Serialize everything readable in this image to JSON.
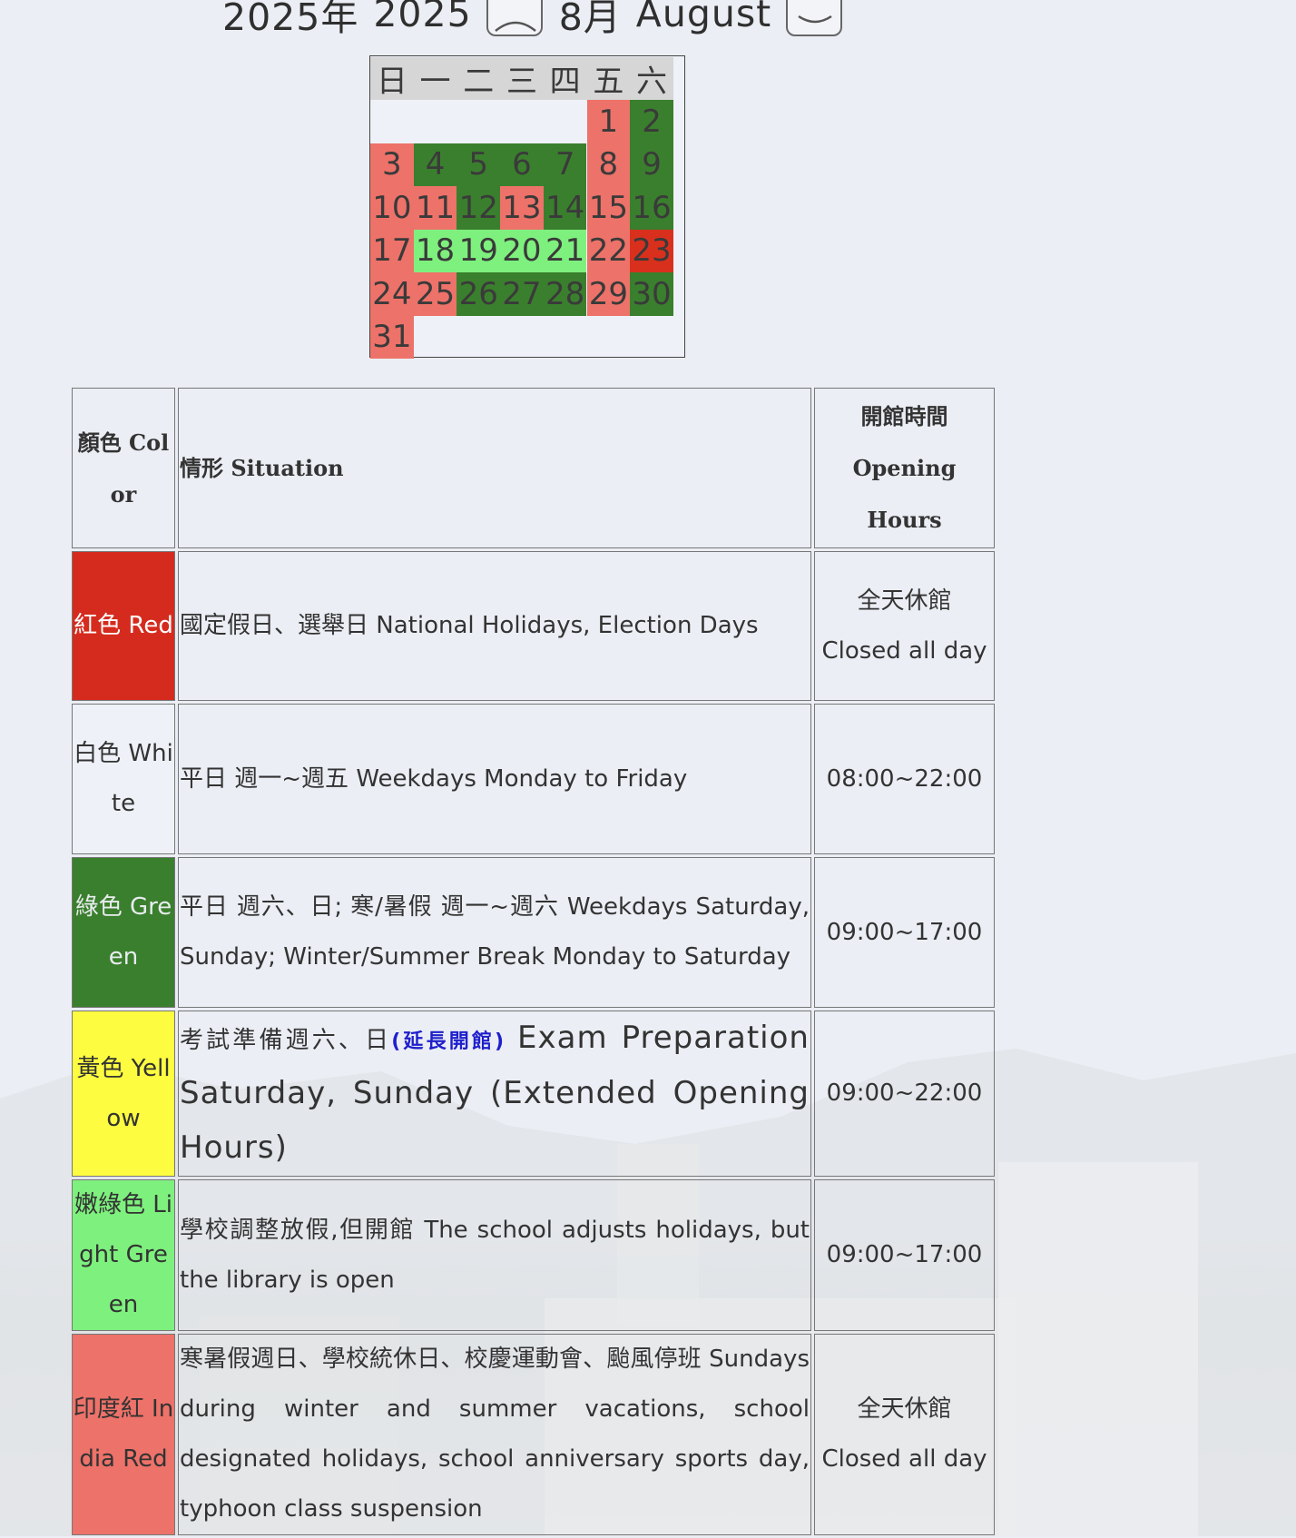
{
  "header": {
    "year_label": "2025年",
    "year_value": "2025",
    "month_label": "8月",
    "month_value": "August"
  },
  "calendar": {
    "weekdays": [
      "日",
      "一",
      "二",
      "三",
      "四",
      "五",
      "六"
    ],
    "days": [
      {
        "day": "1",
        "col": 5,
        "row": 0,
        "color": "#ed7269"
      },
      {
        "day": "2",
        "col": 6,
        "row": 0,
        "color": "#3a7f2d"
      },
      {
        "day": "3",
        "col": 0,
        "row": 1,
        "color": "#ed7269"
      },
      {
        "day": "4",
        "col": 1,
        "row": 1,
        "color": "#3a7f2d"
      },
      {
        "day": "5",
        "col": 2,
        "row": 1,
        "color": "#3a7f2d"
      },
      {
        "day": "6",
        "col": 3,
        "row": 1,
        "color": "#3a7f2d"
      },
      {
        "day": "7",
        "col": 4,
        "row": 1,
        "color": "#3a7f2d"
      },
      {
        "day": "8",
        "col": 5,
        "row": 1,
        "color": "#ed7269"
      },
      {
        "day": "9",
        "col": 6,
        "row": 1,
        "color": "#3a7f2d"
      },
      {
        "day": "10",
        "col": 0,
        "row": 2,
        "color": "#ed7269"
      },
      {
        "day": "11",
        "col": 1,
        "row": 2,
        "color": "#ed7269"
      },
      {
        "day": "12",
        "col": 2,
        "row": 2,
        "color": "#3a7f2d"
      },
      {
        "day": "13",
        "col": 3,
        "row": 2,
        "color": "#ed7269"
      },
      {
        "day": "14",
        "col": 4,
        "row": 2,
        "color": "#3a7f2d"
      },
      {
        "day": "15",
        "col": 5,
        "row": 2,
        "color": "#ed7269"
      },
      {
        "day": "16",
        "col": 6,
        "row": 2,
        "color": "#3a7f2d"
      },
      {
        "day": "17",
        "col": 0,
        "row": 3,
        "color": "#ed7269"
      },
      {
        "day": "18",
        "col": 1,
        "row": 3,
        "color": "#7ef07e"
      },
      {
        "day": "19",
        "col": 2,
        "row": 3,
        "color": "#7ef07e"
      },
      {
        "day": "20",
        "col": 3,
        "row": 3,
        "color": "#7ef07e"
      },
      {
        "day": "21",
        "col": 4,
        "row": 3,
        "color": "#7ef07e"
      },
      {
        "day": "22",
        "col": 5,
        "row": 3,
        "color": "#ed7269"
      },
      {
        "day": "23",
        "col": 6,
        "row": 3,
        "color": "#d9301e"
      },
      {
        "day": "24",
        "col": 0,
        "row": 4,
        "color": "#ed7269"
      },
      {
        "day": "25",
        "col": 1,
        "row": 4,
        "color": "#ed7269"
      },
      {
        "day": "26",
        "col": 2,
        "row": 4,
        "color": "#3a7f2d"
      },
      {
        "day": "27",
        "col": 3,
        "row": 4,
        "color": "#3a7f2d"
      },
      {
        "day": "28",
        "col": 4,
        "row": 4,
        "color": "#3a7f2d"
      },
      {
        "day": "29",
        "col": 5,
        "row": 4,
        "color": "#ed7269"
      },
      {
        "day": "30",
        "col": 6,
        "row": 4,
        "color": "#3a7f2d"
      },
      {
        "day": "31",
        "col": 0,
        "row": 5,
        "color": "#ed7269"
      }
    ]
  },
  "legend": {
    "headers": {
      "color": "顏色 Color",
      "situation": "情形 Situation",
      "hours": "開館時間 Opening Hours"
    },
    "rows": [
      {
        "color_name": "紅色 Red",
        "bg": "#d52b1e",
        "text_color": "#ffffff",
        "situation": "國定假日、選舉日  National Holidays, Election Days",
        "hours": "全天休館 Closed all day"
      },
      {
        "color_name": "白色 White",
        "bg": "#eef1f7",
        "text_color": "#333333",
        "situation": "平日 週一~週五  Weekdays Monday to Friday",
        "hours": "08:00~22:00"
      },
      {
        "color_name": "綠色 Green",
        "bg": "#3a7f2d",
        "text_color": "#e8ecef",
        "situation": "平日 週六、日;   寒/暑假 週一~週六  Weekdays Saturday, Sunday; Winter/Summer Break Monday to Saturday",
        "hours": "09:00~17:00"
      },
      {
        "color_name": "黃色 Yellow",
        "bg": "#fdfc40",
        "text_color": "#333333",
        "situation_a": "考試準備週六、日",
        "situation_b": "(延長開館)",
        "situation_c": " Exam Preparation Saturday, Sunday (Extended Opening Hours)",
        "hours": "09:00~22:00"
      },
      {
        "color_name": "嫩綠色 Light Green",
        "bg": "#7ef07e",
        "text_color": "#333333",
        "situation": "學校調整放假,但開館  The school adjusts holidays, but the library is open",
        "hours": "09:00~17:00"
      },
      {
        "color_name": "印度紅 India Red",
        "bg": "#ed7269",
        "text_color": "#333333",
        "situation": "寒暑假週日、學校統休日、校慶運動會、颱風停班  Sundays during winter and summer vacations, school designated holidays, school anniversary sports day, typhoon class suspension",
        "hours": "全天休館 Closed all day"
      }
    ]
  }
}
